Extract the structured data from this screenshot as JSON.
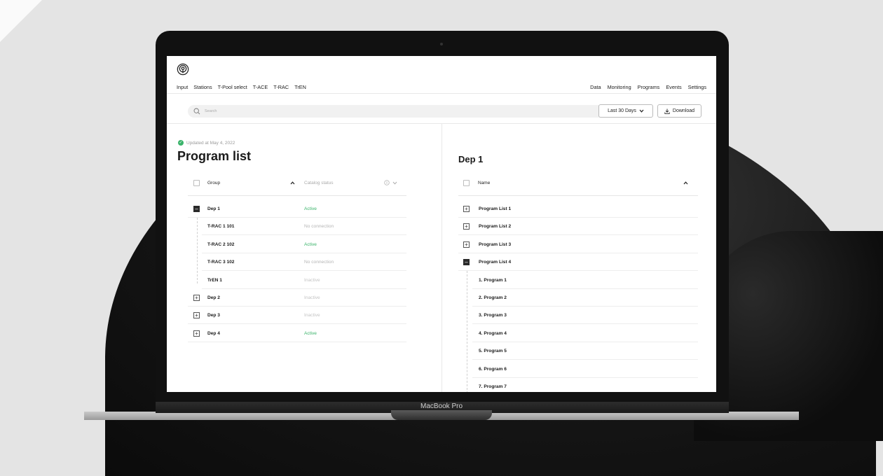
{
  "app": {
    "nav_left": [
      "Input",
      "Stations",
      "T-Pool select",
      "T-ACE",
      "T-RAC",
      "TrEN"
    ],
    "nav_right": [
      "Data",
      "Monitoring",
      "Programs",
      "Events",
      "Settings"
    ],
    "search_placeholder": "Search",
    "date_range": "Last 30 Days",
    "download_label": "Download"
  },
  "left_panel": {
    "updated_text": "Updated at May 4, 2022",
    "title": "Program list",
    "col_group": "Group",
    "col_status": "Catalog status",
    "rows": [
      {
        "name": "Dep 1",
        "status": "Active",
        "level": 0,
        "toggle": "minus"
      },
      {
        "name": "T-RAC 1 101",
        "status": "No connection",
        "level": 1,
        "toggle": "none"
      },
      {
        "name": "T-RAC 2 102",
        "status": "Active",
        "level": 1,
        "toggle": "none"
      },
      {
        "name": "T-RAC 3 102",
        "status": "No connection",
        "level": 1,
        "toggle": "none"
      },
      {
        "name": "TrEN 1",
        "status": "Inactive",
        "level": 1,
        "toggle": "none"
      },
      {
        "name": "Dep 2",
        "status": "Inactive",
        "level": 0,
        "toggle": "plus"
      },
      {
        "name": "Dep 3",
        "status": "Inactive",
        "level": 0,
        "toggle": "plus"
      },
      {
        "name": "Dep 4",
        "status": "Active",
        "level": 0,
        "toggle": "plus"
      }
    ]
  },
  "right_panel": {
    "title": "Dep 1",
    "col_name": "Name",
    "rows": [
      {
        "name": "Program List 1",
        "level": 0,
        "toggle": "plus"
      },
      {
        "name": "Program List 2",
        "level": 0,
        "toggle": "plus"
      },
      {
        "name": "Program List 3",
        "level": 0,
        "toggle": "plus"
      },
      {
        "name": "Program List 4",
        "level": 0,
        "toggle": "minus"
      },
      {
        "name": "1. Program 1",
        "level": 1,
        "toggle": "none"
      },
      {
        "name": "2. Program 2",
        "level": 1,
        "toggle": "none"
      },
      {
        "name": "3. Program 3",
        "level": 1,
        "toggle": "none"
      },
      {
        "name": "4. Program 4",
        "level": 1,
        "toggle": "none"
      },
      {
        "name": "5. Program 5",
        "level": 1,
        "toggle": "none"
      },
      {
        "name": "6. Program 6",
        "level": 1,
        "toggle": "none"
      },
      {
        "name": "7. Program 7",
        "level": 1,
        "toggle": "none"
      }
    ]
  },
  "device_label": "MacBook Pro",
  "colors": {
    "active": "#3ab36a",
    "muted": "#b5b5b5",
    "inactive": "#c4c4c4"
  }
}
